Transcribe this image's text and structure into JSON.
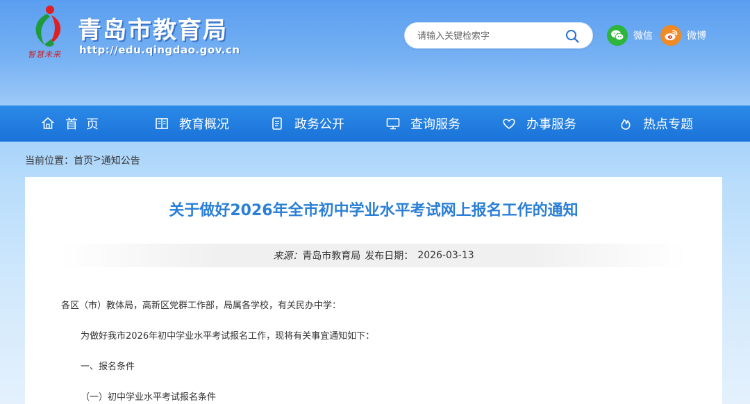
{
  "header": {
    "site_title": "青岛市教育局",
    "site_url": "http://edu.qingdao.gov.cn",
    "logo_caption": "智慧未来",
    "search": {
      "placeholder": "请输入关键检索字"
    },
    "social": [
      {
        "label": "微信",
        "icon": "wechat-icon",
        "color": "#2db53c"
      },
      {
        "label": "微博",
        "icon": "weibo-icon",
        "color": "#f08a24"
      }
    ]
  },
  "nav": {
    "items": [
      {
        "label": "首页",
        "icon": "home-icon"
      },
      {
        "label": "教育概况",
        "icon": "book-icon"
      },
      {
        "label": "政务公开",
        "icon": "document-icon"
      },
      {
        "label": "查询服务",
        "icon": "monitor-icon"
      },
      {
        "label": "办事服务",
        "icon": "heart-icon"
      },
      {
        "label": "热点专题",
        "icon": "flame-icon"
      }
    ]
  },
  "breadcrumb": {
    "prefix": "当前位置：",
    "home": "首页",
    "separator": ">",
    "current": "通知公告"
  },
  "article": {
    "title": "关于做好2026年全市初中学业水平考试网上报名工作的通知",
    "source_label": "来源：",
    "source_value": "青岛市教育局",
    "date_label": "发布日期：",
    "date_value": "2026-03-13",
    "paragraphs": [
      "各区（市）教体局，高新区党群工作部，局属各学校，有关民办中学：",
      "为做好我市2026年初中学业水平考试报名工作，现将有关事宜通知如下：",
      "一、报名条件",
      "（一）初中学业水平考试报名条件"
    ]
  },
  "colors": {
    "nav_bg": "#1e7ad9",
    "title_blue": "#2a7fd6",
    "header_bg": "#6aaaf2"
  }
}
